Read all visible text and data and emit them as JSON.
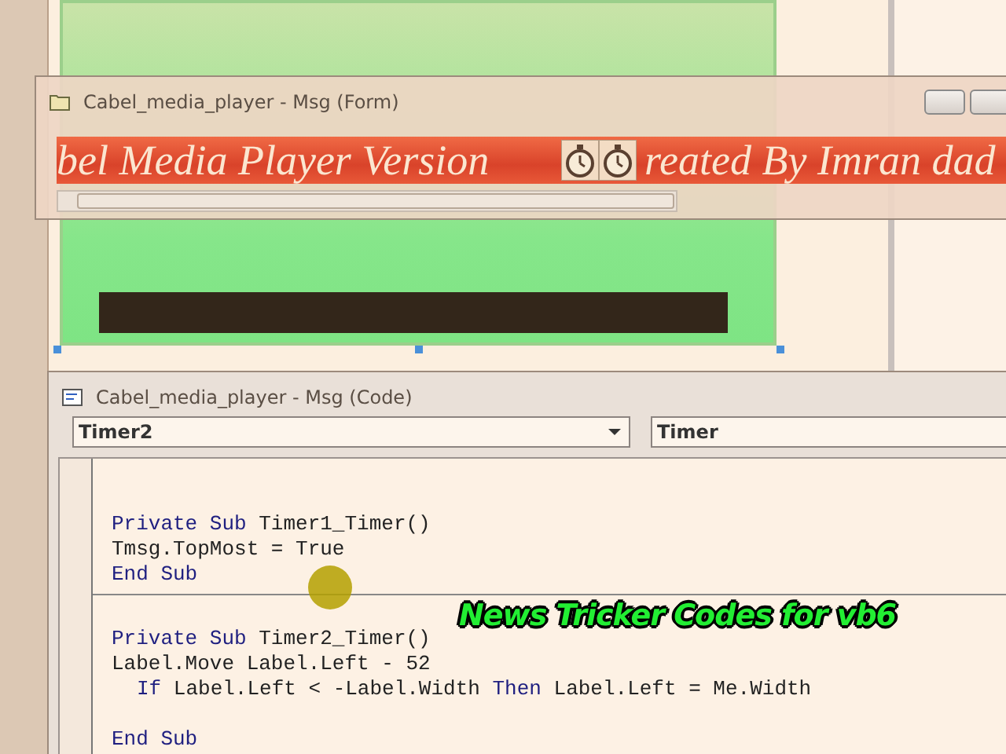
{
  "form_window": {
    "title": "Cabel_media_player - Msg (Form)",
    "label_segments": [
      "bel Media Player Version",
      "reated By Imran dad"
    ]
  },
  "code_window": {
    "title": "Cabel_media_player - Msg (Code)",
    "object_combo": "Timer2",
    "procedure_combo": "Timer",
    "procedures": [
      {
        "lines": [
          {
            "kind": "code",
            "tokens": [
              {
                "text": "Private Sub",
                "kind": "keyword"
              },
              {
                "text": " Timer1_Timer()",
                "kind": "plain"
              }
            ]
          },
          {
            "kind": "code",
            "tokens": [
              {
                "text": "Tmsg.TopMost = True",
                "kind": "plain"
              }
            ]
          },
          {
            "kind": "code",
            "tokens": [
              {
                "text": "End Sub",
                "kind": "keyword"
              }
            ]
          }
        ]
      },
      {
        "lines": [
          {
            "kind": "code",
            "tokens": [
              {
                "text": "Private Sub",
                "kind": "keyword"
              },
              {
                "text": " Timer2_Timer()",
                "kind": "plain"
              }
            ]
          },
          {
            "kind": "code",
            "tokens": [
              {
                "text": "Label.Move Label.Left - 52",
                "kind": "plain"
              }
            ]
          },
          {
            "kind": "code",
            "indented": true,
            "tokens": [
              {
                "text": "If",
                "kind": "keyword"
              },
              {
                "text": " Label.Left < -Label.Width ",
                "kind": "plain"
              },
              {
                "text": "Then",
                "kind": "keyword"
              },
              {
                "text": " Label.Left = Me.Width",
                "kind": "plain"
              }
            ]
          },
          {
            "kind": "blank"
          },
          {
            "kind": "code",
            "tokens": [
              {
                "text": "End Sub",
                "kind": "keyword"
              }
            ]
          }
        ]
      }
    ]
  },
  "caption": "News Tricker Codes for vb6"
}
